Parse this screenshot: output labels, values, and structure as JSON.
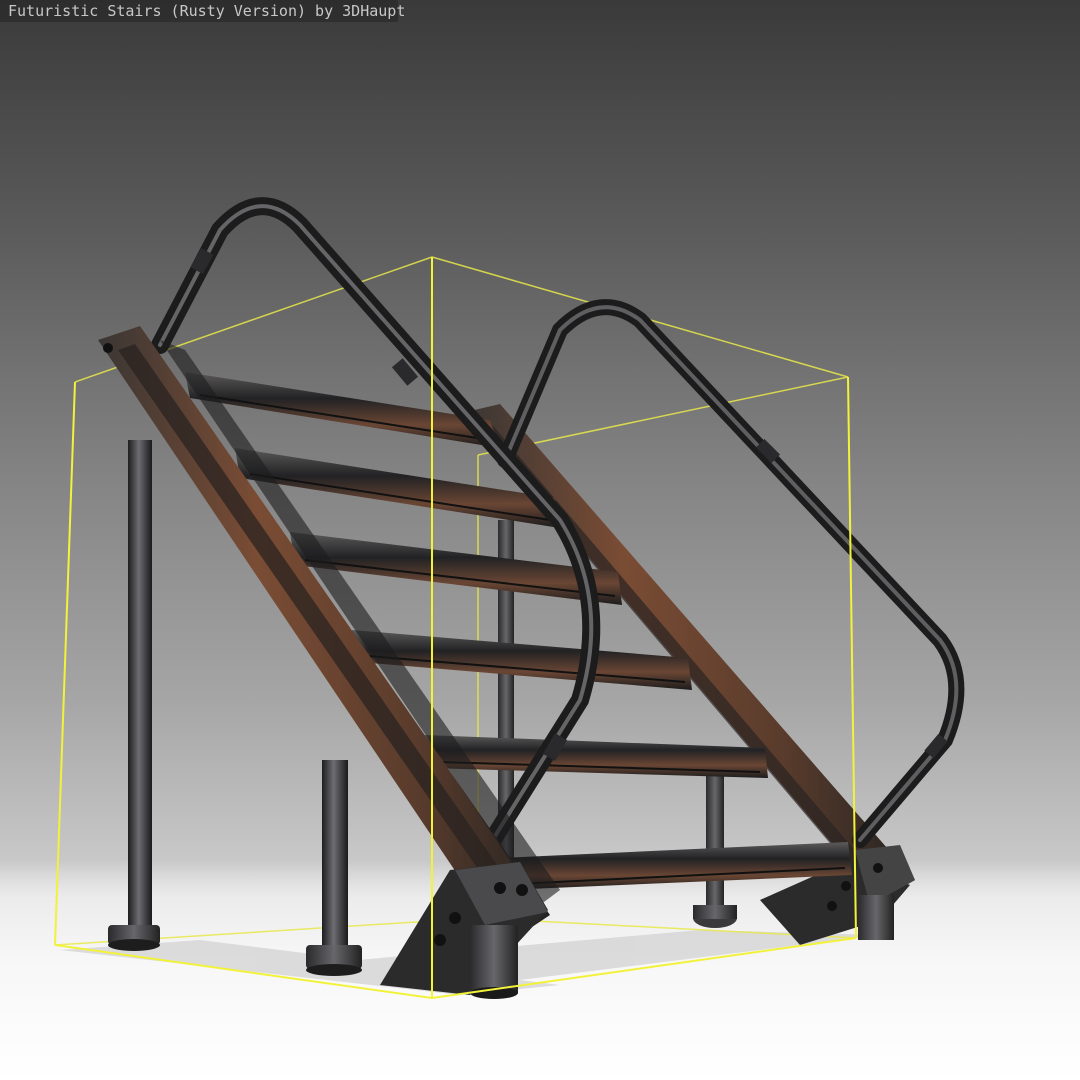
{
  "viewer": {
    "title": "Futuristic Stairs (Rusty Version) by 3DHaupt"
  },
  "colors": {
    "bounding_box": "#f2f23a",
    "rust": "#8a4a2e",
    "metal": "#2b2b2d",
    "metal_light": "#6a6a6e"
  },
  "model": {
    "icon": "staircase-model",
    "selected": true
  }
}
